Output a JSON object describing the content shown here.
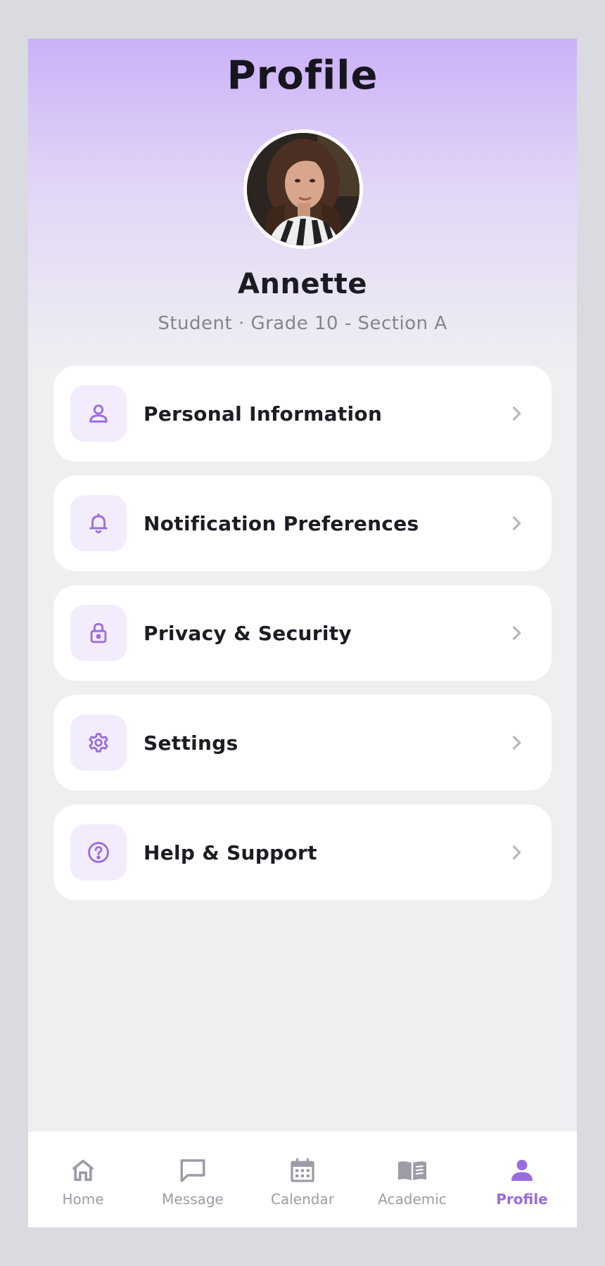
{
  "header": {
    "title": "Profile"
  },
  "profile": {
    "name": "Annette",
    "subtitle": "Student · Grade 10 - Section A"
  },
  "menu": {
    "items": [
      {
        "label": "Personal Information",
        "icon": "person-icon"
      },
      {
        "label": "Notification Preferences",
        "icon": "bell-icon"
      },
      {
        "label": "Privacy & Security",
        "icon": "lock-icon"
      },
      {
        "label": "Settings",
        "icon": "gear-icon"
      },
      {
        "label": "Help & Support",
        "icon": "help-circle-icon"
      }
    ]
  },
  "tabbar": {
    "active": "Profile",
    "tabs": [
      {
        "label": "Home",
        "icon": "home-icon"
      },
      {
        "label": "Message",
        "icon": "message-icon"
      },
      {
        "label": "Calendar",
        "icon": "calendar-icon"
      },
      {
        "label": "Academic",
        "icon": "book-icon"
      },
      {
        "label": "Profile",
        "icon": "person-icon"
      }
    ]
  },
  "colors": {
    "accent": "#9a6ce0",
    "icon_bg": "#f2ecfd",
    "background": "#efeff2",
    "header_gradient_top": "#cbb1f7",
    "text_primary": "#1c1c24",
    "text_secondary": "#84848f",
    "tab_inactive": "#9c9ca8"
  }
}
